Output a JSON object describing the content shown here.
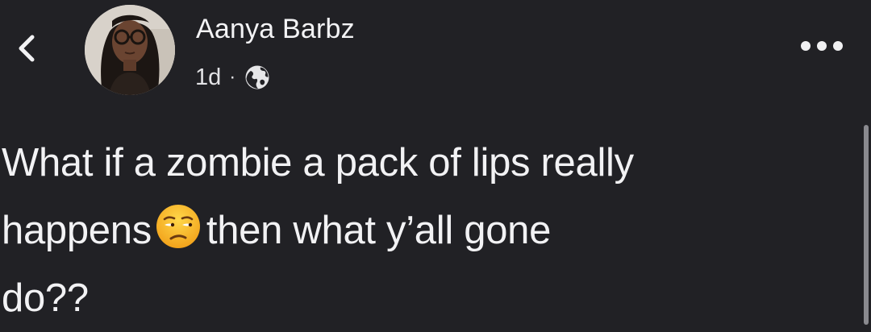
{
  "header": {
    "back_icon": "chevron-left-icon",
    "avatar_icon": "profile-photo",
    "author_name": "Aanya Barbz",
    "timestamp": "1d",
    "separator": "·",
    "audience_icon": "globe-icon",
    "more_icon": "ellipsis-horizontal-icon"
  },
  "post": {
    "line1": "What if a zombie a pack of lips really",
    "line2_before_emoji": "happens",
    "emoji_icon": "unamused-face-emoji",
    "line2_after_emoji": "then what y’all gone",
    "line3": "do??"
  },
  "colors": {
    "background": "#212125",
    "text": "#f2f2f4",
    "scrollbar": "#8a8a8f"
  }
}
